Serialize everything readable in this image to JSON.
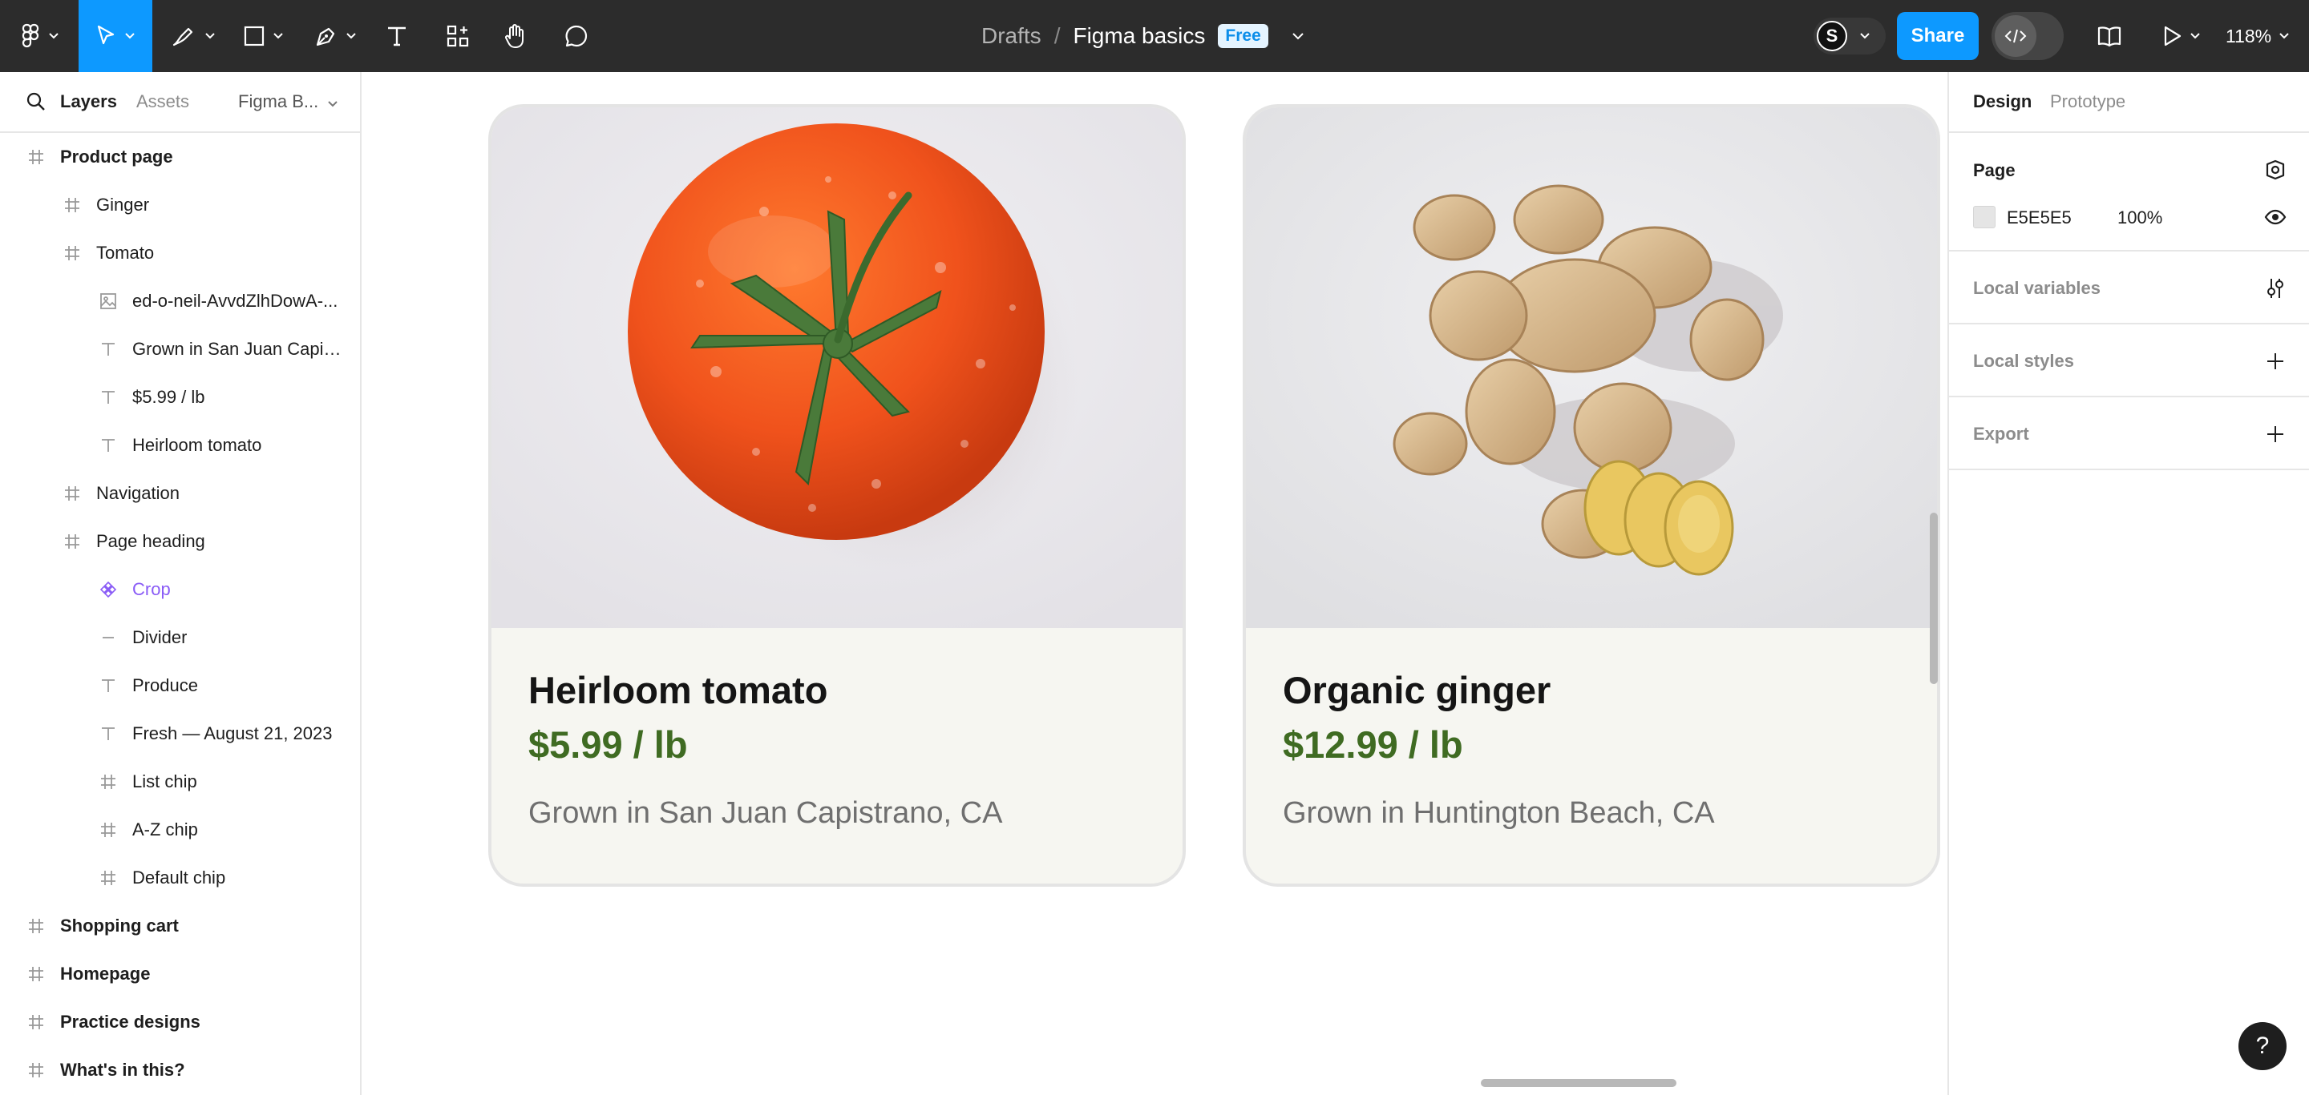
{
  "toolbar": {
    "breadcrumb_folder": "Drafts",
    "breadcrumb_separator": "/",
    "file_name": "Figma basics",
    "plan_badge": "Free",
    "user_initial": "S",
    "share_label": "Share",
    "zoom": "118%",
    "accent_color": "#0d99ff",
    "tools": [
      "figma-menu-icon",
      "move-tool-icon",
      "pen-pencil-icon",
      "frame-rectangle-icon",
      "vector-pen-icon",
      "text-tool-icon",
      "components-icon",
      "hand-tool-icon",
      "comment-icon"
    ],
    "active_tool": "move-tool-icon"
  },
  "left_panel": {
    "tabs": [
      "Layers",
      "Assets"
    ],
    "active_tab": "Layers",
    "page_selector": "Figma B...",
    "layers": [
      {
        "label": "Product page",
        "icon": "frame-icon",
        "bold": true
      },
      {
        "label": "Ginger",
        "icon": "frame-icon"
      },
      {
        "label": "Tomato",
        "icon": "frame-icon"
      },
      {
        "label": "ed-o-neil-AvvdZlhDowA-...",
        "icon": "image-icon"
      },
      {
        "label": "Grown in San Juan Capist...",
        "icon": "text-icon"
      },
      {
        "label": "$5.99 / lb",
        "icon": "text-icon"
      },
      {
        "label": "Heirloom tomato",
        "icon": "text-icon"
      },
      {
        "label": "Navigation",
        "icon": "frame-icon"
      },
      {
        "label": "Page heading",
        "icon": "frame-icon"
      },
      {
        "label": "Crop",
        "icon": "component-instance-icon"
      },
      {
        "label": "Divider",
        "icon": "line-icon"
      },
      {
        "label": "Produce",
        "icon": "text-icon"
      },
      {
        "label": "Fresh — August 21, 2023",
        "icon": "text-icon"
      },
      {
        "label": "List chip",
        "icon": "frame-icon"
      },
      {
        "label": "A-Z chip",
        "icon": "frame-icon"
      },
      {
        "label": "Default chip",
        "icon": "frame-icon"
      },
      {
        "label": "Shopping cart",
        "icon": "frame-icon",
        "bold": true
      },
      {
        "label": "Homepage",
        "icon": "frame-icon",
        "bold": true
      },
      {
        "label": "Practice designs",
        "icon": "frame-icon",
        "bold": true
      },
      {
        "label": "What's in this?",
        "icon": "frame-icon",
        "bold": true
      }
    ]
  },
  "canvas": {
    "cards": [
      {
        "title": "Heirloom tomato",
        "price": "$5.99 / lb",
        "origin": "Grown in San Juan Capistrano, CA",
        "image": "tomato-photo"
      },
      {
        "title": "Organic ginger",
        "price": "$12.99 / lb",
        "origin": "Grown in Huntington Beach, CA",
        "image": "ginger-photo"
      }
    ],
    "price_color": "#3f6b22"
  },
  "right_panel": {
    "tabs": [
      "Design",
      "Prototype"
    ],
    "active_tab": "Design",
    "page_section": {
      "title": "Page",
      "color_hex": "E5E5E5",
      "opacity": "100%"
    },
    "sections": [
      "Local variables",
      "Local styles",
      "Export"
    ]
  },
  "help_label": "?"
}
